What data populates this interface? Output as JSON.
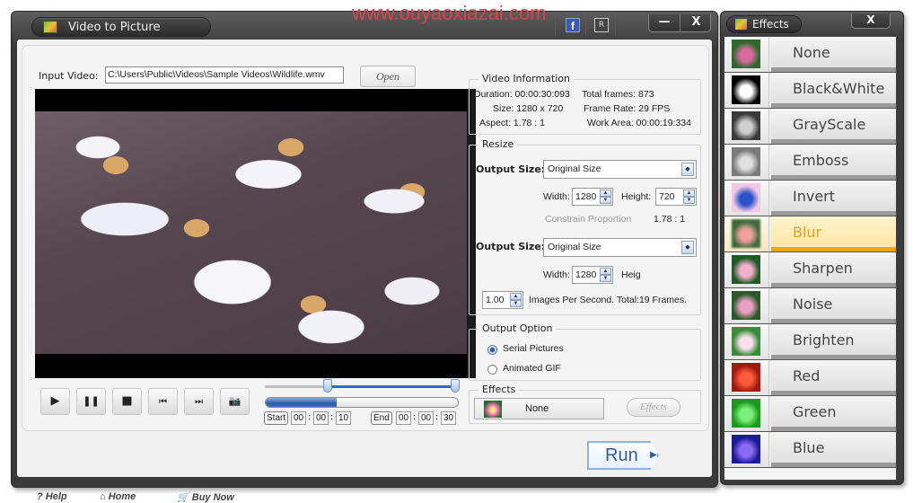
{
  "watermark": "www.ouyaoxiazai.com",
  "window": {
    "title": "Video to Picture",
    "icons": {
      "facebook": "f",
      "register": "R"
    },
    "minimize_label": "—",
    "close_label": "X"
  },
  "input": {
    "label": "Input Video:",
    "path": "C:\\Users\\Public\\Videos\\Sample Videos\\Wildlife.wmv",
    "open_label": "Open"
  },
  "video_info": {
    "title": "Video Information",
    "duration": "Duration:  00:00:30:093",
    "total_frames": "Total frames: 873",
    "size": "Size:  1280 x 720",
    "frame_rate": "Frame Rate: 29 FPS",
    "aspect": "Aspect:  1.78 : 1",
    "work_area": "Work Area: 00:00:19:334"
  },
  "resize": {
    "title": "Resize",
    "output_size_label": "Output Size:",
    "output_size_value": "Original Size",
    "width_label": "Width:",
    "width_value": "1280",
    "height_label": "Height:",
    "height_value": "720",
    "constrain_ghost": "Constrain Proportion",
    "ratio": "1.78 : 1",
    "output_size_value_2": "Original Size",
    "width_value_2": "1280",
    "height_label_partial": "Heig"
  },
  "fps": {
    "value": "1.00",
    "label": "Images Per Second. Total:19 Frames."
  },
  "output_option": {
    "title": "Output Option",
    "options": [
      {
        "label": "Serial Pictures",
        "selected": true
      },
      {
        "label": "Animated GIF",
        "selected": false
      }
    ]
  },
  "effects_group": {
    "title": "Effects",
    "current": "None",
    "button_label": "Effects"
  },
  "playback": {
    "buttons": [
      {
        "name": "play",
        "glyph": "▶"
      },
      {
        "name": "pause",
        "glyph": "❚❚"
      },
      {
        "name": "stop",
        "glyph": "■"
      },
      {
        "name": "previous",
        "glyph": "⏮"
      },
      {
        "name": "next",
        "glyph": "⏭"
      },
      {
        "name": "snapshot",
        "glyph": "📷"
      }
    ],
    "range_start_fraction": 0.33,
    "range_end_fraction": 1.0,
    "progress_fraction": 0.37,
    "start_label": "Start",
    "start": [
      "00",
      "00",
      "10"
    ],
    "end_label": "End",
    "end": [
      "00",
      "00",
      "30"
    ]
  },
  "footer": {
    "help": "Help",
    "home": "Home",
    "buy_now": "Buy Now",
    "run": "Run"
  },
  "effects_window": {
    "title": "Effects",
    "close_label": "X",
    "items": [
      {
        "label": "None",
        "tint": "#d86aa0",
        "bg": "#2e6a2e",
        "active": false
      },
      {
        "label": "Black&White",
        "tint": "#ffffff",
        "bg": "#000000",
        "active": false
      },
      {
        "label": "GrayScale",
        "tint": "#cfcfcf",
        "bg": "#3a3a3a",
        "active": false
      },
      {
        "label": "Emboss",
        "tint": "#e0e0e0",
        "bg": "#7a7a7a",
        "active": false
      },
      {
        "label": "Invert",
        "tint": "#2a52c8",
        "bg": "#f4c8e4",
        "active": false
      },
      {
        "label": "Blur",
        "tint": "#f0a0a0",
        "bg": "#3a6a3a",
        "active": true
      },
      {
        "label": "Sharpen",
        "tint": "#f2b0cc",
        "bg": "#1e5a24",
        "active": false
      },
      {
        "label": "Noise",
        "tint": "#e8a0c0",
        "bg": "#2a5a2a",
        "active": false
      },
      {
        "label": "Brighten",
        "tint": "#fce0ec",
        "bg": "#3c8a3c",
        "active": false
      },
      {
        "label": "Red",
        "tint": "#ff5a3a",
        "bg": "#a01a10",
        "active": false
      },
      {
        "label": "Green",
        "tint": "#7cf07c",
        "bg": "#1a9a1a",
        "active": false
      },
      {
        "label": "Blue",
        "tint": "#8a6af0",
        "bg": "#1a1a9a",
        "active": false
      }
    ]
  }
}
